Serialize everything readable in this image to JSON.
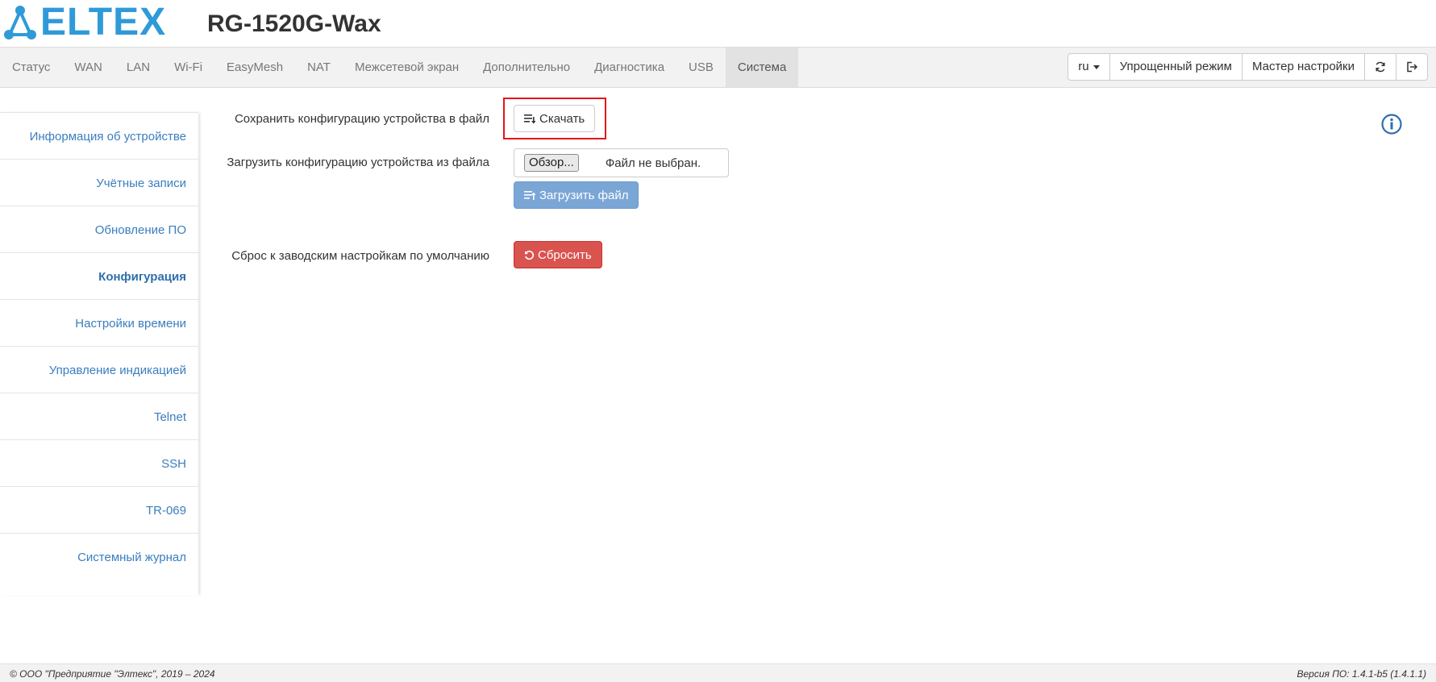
{
  "header": {
    "logo_text": "ELTEX",
    "device_model": "RG-1520G-Wax"
  },
  "nav": {
    "items": [
      {
        "label": "Статус"
      },
      {
        "label": "WAN"
      },
      {
        "label": "LAN"
      },
      {
        "label": "Wi-Fi"
      },
      {
        "label": "EasyMesh"
      },
      {
        "label": "NAT"
      },
      {
        "label": "Межсетевой экран"
      },
      {
        "label": "Дополнительно"
      },
      {
        "label": "Диагностика"
      },
      {
        "label": "USB"
      },
      {
        "label": "Система",
        "active": true
      }
    ],
    "language": "ru",
    "simple_mode_label": "Упрощенный режим",
    "wizard_label": "Мастер настройки"
  },
  "sidebar": {
    "items": [
      {
        "label": "Информация об устройстве"
      },
      {
        "label": "Учётные записи"
      },
      {
        "label": "Обновление ПО"
      },
      {
        "label": "Конфигурация",
        "active": true
      },
      {
        "label": "Настройки времени"
      },
      {
        "label": "Управление индикацией"
      },
      {
        "label": "Telnet"
      },
      {
        "label": "SSH"
      },
      {
        "label": "TR-069"
      },
      {
        "label": "Системный журнал"
      }
    ]
  },
  "config": {
    "save_label": "Сохранить конфигурацию устройства в файл",
    "download_button": "Скачать",
    "load_label": "Загрузить конфигурацию устройства из файла",
    "browse_button": "Обзор...",
    "file_status": "Файл не выбран.",
    "upload_button": "Загрузить файл",
    "reset_label": "Сброс к заводским настройкам по умолчанию",
    "reset_button": "Сбросить"
  },
  "footer": {
    "copyright": "© ООО \"Предприятие \"Элтекс\", 2019 – 2024",
    "version": "Версия ПО: 1.4.1-b5 (1.4.1.1)"
  },
  "colors": {
    "brand": "#2f9ad8",
    "link": "#3a7ebf",
    "danger": "#d9534f",
    "primary_disabled": "#7aa6d6",
    "highlight": "#e3151a"
  },
  "icons": {
    "logo": "eltex-network-logo-icon",
    "download": "list-download-icon",
    "upload": "list-upload-icon",
    "reset": "undo-icon",
    "refresh": "refresh-icon",
    "logout": "logout-icon",
    "info": "info-circle-icon"
  }
}
